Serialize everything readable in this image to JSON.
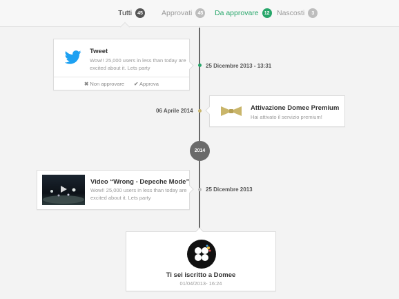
{
  "tabs": [
    {
      "label": "Tutti",
      "count": "45"
    },
    {
      "label": "Approvati",
      "count": "45"
    },
    {
      "label": "Da approvare",
      "count": "12"
    },
    {
      "label": "Nascosti",
      "count": "3"
    }
  ],
  "colors": {
    "accent_green": "#27a66a",
    "timeline": "#6a6a6a",
    "twitter_blue": "#1da1f2",
    "bowtie_gold": "#c9b56a"
  },
  "tweet": {
    "icon": "twitter-bird-icon",
    "title": "Tweet",
    "text": "Wow!! 25,000 users in less than today are excited about it. Lets party",
    "reject": "Non approvare",
    "approve": "Approva",
    "date": "25 Dicembre 2013 - 13:31"
  },
  "premium": {
    "icon": "bowtie-icon",
    "title": "Attivazione Domee Premium",
    "text": "Hai attivato il servizio premium!",
    "date": "06 Aprile 2014"
  },
  "year_marker": "2014",
  "video": {
    "title": "Video “Wrong - Depeche Mode”",
    "text": "Wow!! 25,000 users in less than today are excited about it. Lets party",
    "date": "25 Dicembre 2013"
  },
  "signup": {
    "icon": "domee-logo-icon",
    "title": "Ti sei iscritto a Domee",
    "date": "01/04/2013- 16:24"
  }
}
